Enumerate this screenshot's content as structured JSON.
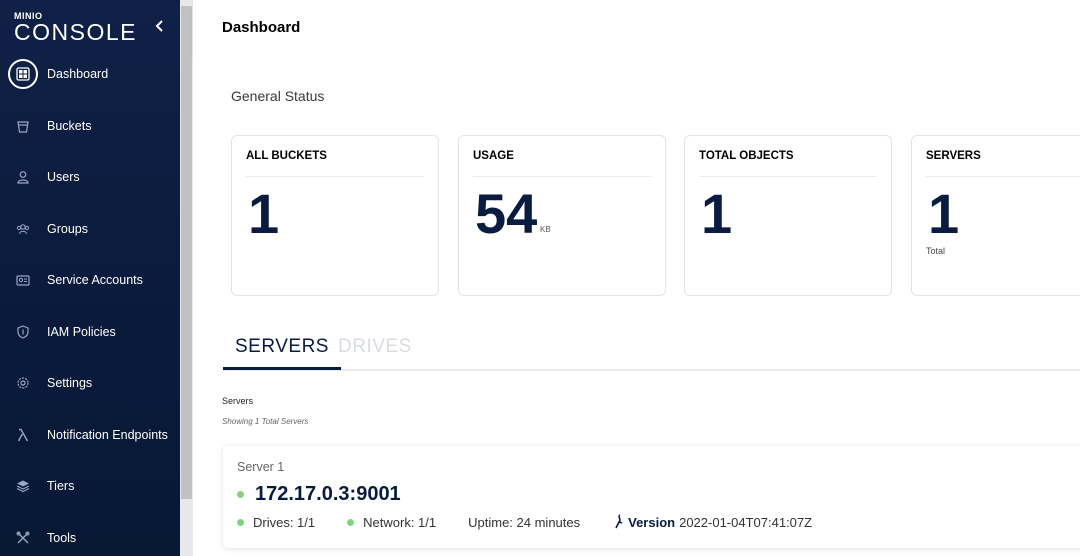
{
  "app": {
    "logo_small": "MINIO",
    "logo_big": "CONSOLE",
    "page_title": "Dashboard"
  },
  "sidebar": {
    "items": [
      {
        "label": "Dashboard",
        "icon": "dashboard-icon",
        "active": true
      },
      {
        "label": "Buckets",
        "icon": "bucket-icon"
      },
      {
        "label": "Users",
        "icon": "user-icon"
      },
      {
        "label": "Groups",
        "icon": "groups-icon"
      },
      {
        "label": "Service Accounts",
        "icon": "service-account-icon"
      },
      {
        "label": "IAM Policies",
        "icon": "shield-icon"
      },
      {
        "label": "Settings",
        "icon": "gear-icon"
      },
      {
        "label": "Notification Endpoints",
        "icon": "lambda-icon"
      },
      {
        "label": "Tiers",
        "icon": "tiers-icon"
      },
      {
        "label": "Tools",
        "icon": "tools-icon"
      }
    ]
  },
  "status": {
    "title": "General Status",
    "cards": [
      {
        "label": "ALL BUCKETS",
        "value": "1"
      },
      {
        "label": "USAGE",
        "value": "54",
        "unit": "KB"
      },
      {
        "label": "TOTAL OBJECTS",
        "value": "1"
      },
      {
        "label": "SERVERS",
        "value": "1",
        "sub": "Total"
      }
    ]
  },
  "tabs": [
    {
      "label": "SERVERS",
      "active": true
    },
    {
      "label": "DRIVES",
      "active": false
    }
  ],
  "servers": {
    "title": "Servers",
    "subtitle": "Showing 1 Total Servers",
    "items": [
      {
        "name": "Server 1",
        "address": "172.17.0.3:9001",
        "drives": "Drives: 1/1",
        "network": "Network: 1/1",
        "uptime": "Uptime: 24 minutes",
        "version_label": "Version",
        "version": "2022-01-04T07:41:07Z"
      }
    ]
  },
  "colors": {
    "sidebar_bg": "#0f2147",
    "accent": "#081c42",
    "status_ok": "#7fd67a"
  }
}
